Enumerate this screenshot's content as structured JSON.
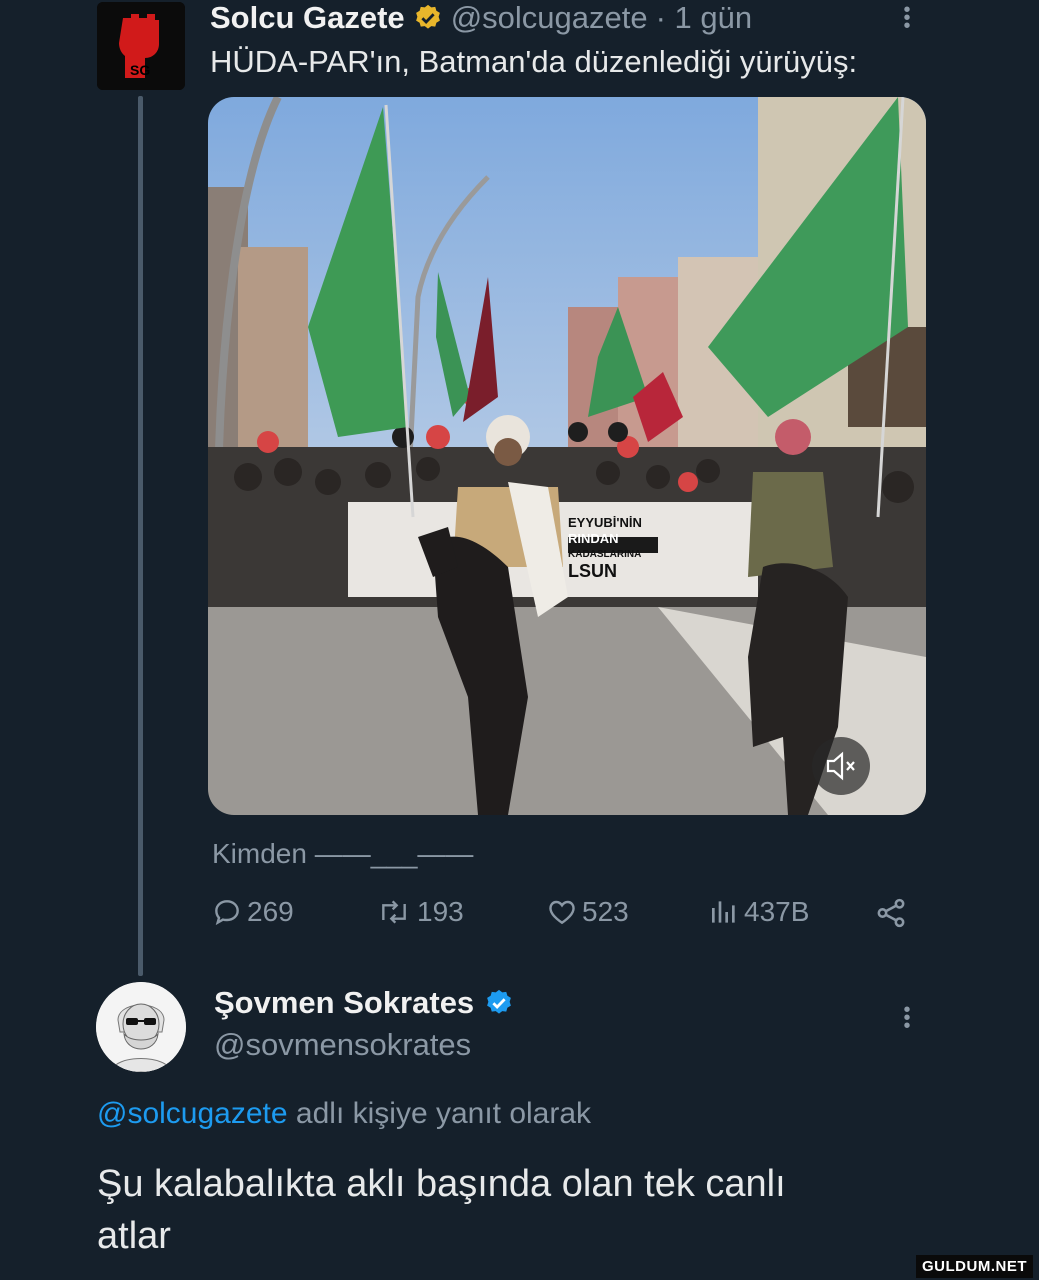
{
  "tweet": {
    "author": "Solcu Gazete",
    "handle": "@solcugazete",
    "time": "· 1 gün",
    "text": "HÜDA-PAR'ın, Batman'da düzenlediği yürüyüş:",
    "avatar_text": "SG",
    "source_text": "Kimden ——___——",
    "banner_lines": [
      "EYYUBİ'NİN",
      "RINDAN",
      "KADASLARINA",
      "LSUN"
    ],
    "metrics": {
      "replies": "269",
      "reposts": "193",
      "likes": "523",
      "views": "437B"
    },
    "icons": {
      "verified": "gold-verified-badge-icon",
      "more": "more-dots-icon",
      "mute": "volume-mute-icon",
      "reply": "reply-bubble-icon",
      "repost": "repost-arrows-icon",
      "like": "heart-icon",
      "views": "bar-chart-icon",
      "share": "share-nodes-icon"
    }
  },
  "reply": {
    "author": "Şovmen Sokrates",
    "handle": "@sovmensokrates",
    "reply_to_handle": "@solcugazete",
    "reply_to_suffix": "adlı kişiye yanıt olarak",
    "text_line1": "Şu kalabalıkta aklı başında olan tek canlı",
    "text_line2": "atlar"
  },
  "watermark": "GULDUM.NET",
  "colors": {
    "background": "#15202b",
    "link": "#1d9bf0",
    "gold_badge": "#e8b62b",
    "blue_badge": "#1d9bf0",
    "muted": "#8b98a5"
  }
}
